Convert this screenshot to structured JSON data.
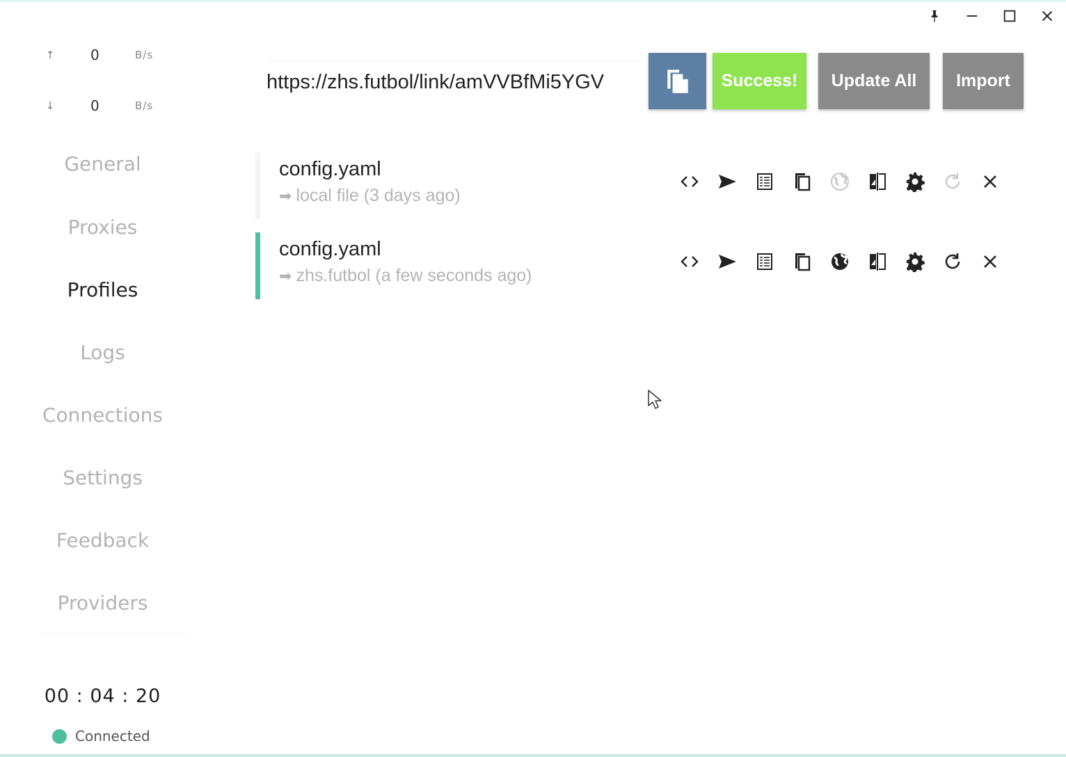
{
  "window_controls": {
    "pin_icon": "pin-icon",
    "minimize_icon": "minimize-icon",
    "maximize_icon": "maximize-icon",
    "close_icon": "close-icon"
  },
  "traffic": {
    "upload": {
      "arrow": "↑",
      "value": "0",
      "unit": "B/s"
    },
    "download": {
      "arrow": "↓",
      "value": "0",
      "unit": "B/s"
    }
  },
  "sidebar": {
    "items": [
      {
        "label": "General",
        "active": false
      },
      {
        "label": "Proxies",
        "active": false
      },
      {
        "label": "Profiles",
        "active": true
      },
      {
        "label": "Logs",
        "active": false
      },
      {
        "label": "Connections",
        "active": false
      },
      {
        "label": "Settings",
        "active": false
      },
      {
        "label": "Feedback",
        "active": false
      },
      {
        "label": "Providers",
        "active": false
      }
    ],
    "timer": "00 : 04 : 20",
    "status": "Connected",
    "status_color": "#4cbf9c"
  },
  "toolbar": {
    "url_value": "https://zhs.futbol/link/amVVBfMi5YGV",
    "paste_icon": "paste-icon",
    "success_label": "Success!",
    "update_all_label": "Update All",
    "import_label": "Import",
    "colors": {
      "paste": "#5d7fa3",
      "success": "#8ee34f",
      "neutral": "#8a8a8a"
    }
  },
  "profiles": [
    {
      "name": "config.yaml",
      "source_arrow": "➡",
      "source": "local file (3 days ago)",
      "selected": false,
      "globe_enabled": false,
      "refresh_enabled": false
    },
    {
      "name": "config.yaml",
      "source_arrow": "➡",
      "source": "zhs.futbol (a few seconds ago)",
      "selected": true,
      "globe_enabled": true,
      "refresh_enabled": true
    }
  ],
  "accent_color": "#4cbfa5"
}
